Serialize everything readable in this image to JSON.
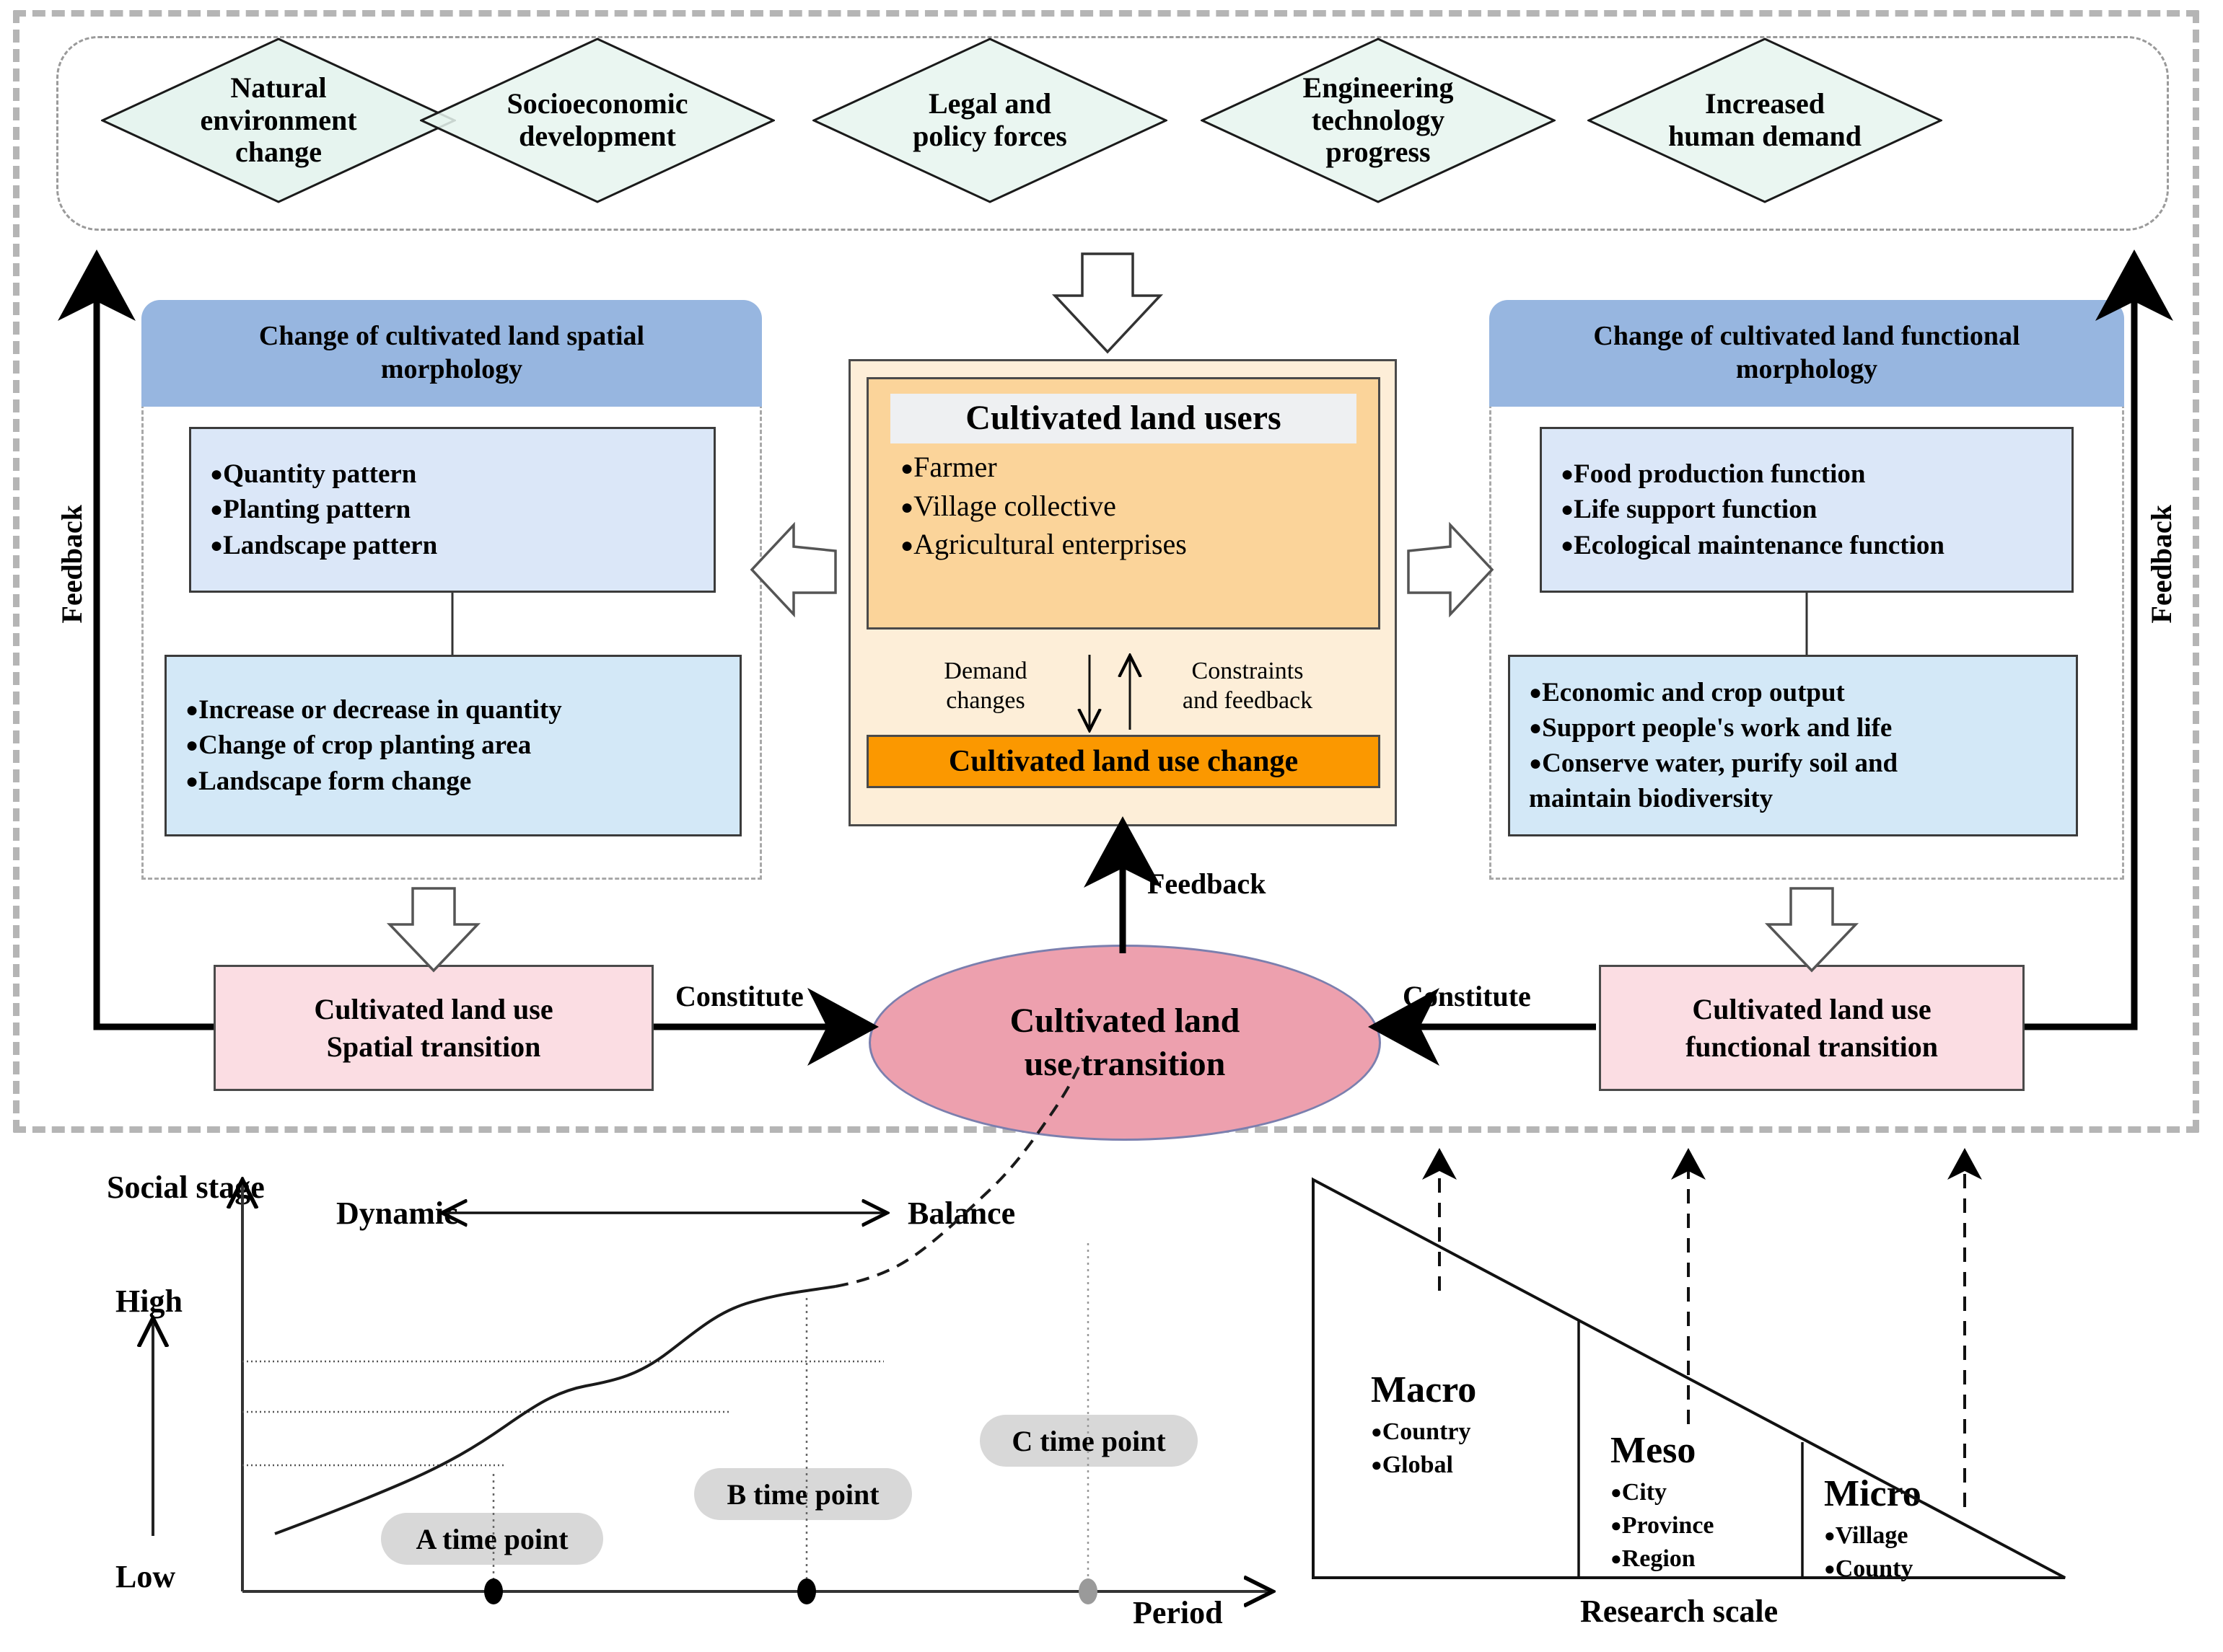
{
  "drivers": {
    "items": [
      {
        "label": "Natural\nenvironment\nchange"
      },
      {
        "label": "Socioeconomic\ndevelopment"
      },
      {
        "label": "Legal and\npolicy forces"
      },
      {
        "label": "Engineering\ntechnology\nprogress"
      },
      {
        "label": "Increased\nhuman demand"
      }
    ]
  },
  "left_panel": {
    "header": "Change of cultivated land spatial\nmorphology",
    "upper_items": [
      "Quantity pattern",
      "Planting pattern",
      "Landscape pattern"
    ],
    "lower_items": [
      "Increase or decrease in quantity",
      "Change of crop planting area",
      "Landscape form change"
    ]
  },
  "center_panel": {
    "users_title": "Cultivated land users",
    "users": [
      "Farmer",
      "Village collective",
      "Agricultural enterprises"
    ],
    "demand_label": "Demand\nchanges",
    "constraints_label": "Constraints\nand feedback",
    "change_box": "Cultivated land use change"
  },
  "right_panel": {
    "header": "Change of cultivated land functional\nmorphology",
    "upper_items": [
      "Food production function",
      "Life support function",
      "Ecological maintenance function"
    ],
    "lower_items": [
      "Economic and crop output",
      "Support people's work and life",
      "Conserve water, purify soil and\nmaintain biodiversity"
    ]
  },
  "transitions": {
    "left_box": "Cultivated land use\nSpatial transition",
    "right_box": "Cultivated land use\nfunctional transition",
    "center_ellipse": "Cultivated land\nuse transition",
    "constitute_left": "Constitute",
    "constitute_right": "Constitute",
    "feedback_center": "Feedback",
    "feedback_left": "Feedback",
    "feedback_right": "Feedback"
  },
  "chart_data": {
    "type": "line",
    "title": "",
    "xlabel": "Period",
    "ylabel": "Social stage",
    "y_ticks": [
      "Low",
      "High"
    ],
    "annotations": [
      "Dynamic",
      "Balance"
    ],
    "series": [
      {
        "name": "observed",
        "style": "solid",
        "x": [
          0.04,
          0.1,
          0.17,
          0.23,
          0.3,
          0.36,
          0.42,
          0.48,
          0.54,
          0.6,
          0.64
        ],
        "y": [
          0.12,
          0.17,
          0.22,
          0.27,
          0.33,
          0.38,
          0.45,
          0.53,
          0.58,
          0.61,
          0.63
        ]
      },
      {
        "name": "projected",
        "style": "dashed",
        "x": [
          0.64,
          0.7,
          0.76,
          0.82,
          0.86,
          0.9,
          0.93
        ],
        "y": [
          0.63,
          0.7,
          0.76,
          0.83,
          0.89,
          0.95,
          1.0
        ]
      }
    ],
    "gridlines_y": [
      0.33,
      0.62,
      0.83
    ],
    "points": [
      {
        "label": "A time point",
        "x": 0.24,
        "filled": true,
        "color": "#000000"
      },
      {
        "label": "B time point",
        "x": 0.5,
        "filled": true,
        "color": "#000000"
      },
      {
        "label": "C time point",
        "x": 0.72,
        "filled": true,
        "color": "#9a9a9a"
      }
    ]
  },
  "research_scale": {
    "axis_label": "Research scale",
    "groups": [
      {
        "title": "Macro",
        "items": [
          "Country",
          "Global"
        ]
      },
      {
        "title": "Meso",
        "items": [
          "City",
          "Province",
          "Region"
        ]
      },
      {
        "title": "Micro",
        "items": [
          "Village",
          "County"
        ]
      }
    ]
  },
  "colors": {
    "diamond_fill": "#e6f4ef",
    "diamond_overlap": "#d7e9e1",
    "blue_header": "#97b6e0",
    "light_blue_box": "#dbe7f8",
    "orange_panel": "#fdeed8",
    "orange_users": "#fbd49a",
    "orange_accent": "#fb9800",
    "pink_box": "#fbdde3",
    "ellipse_fill": "#eda0ae",
    "pill_gray": "#d8d8d8"
  }
}
